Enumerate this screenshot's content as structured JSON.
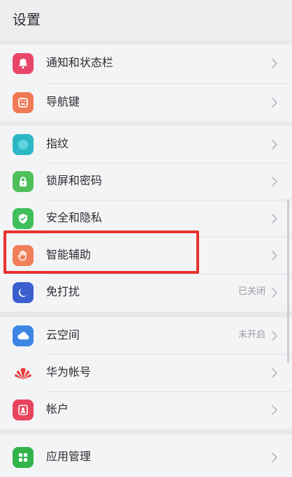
{
  "header": {
    "title": "设置"
  },
  "groups": [
    {
      "items": [
        {
          "label": "通知和状态栏",
          "icon": "bell-icon",
          "color": "#e9476a"
        },
        {
          "label": "导航键",
          "icon": "navigation-keys-icon",
          "color": "#f07a55"
        }
      ]
    },
    {
      "items": [
        {
          "label": "指纹",
          "icon": "fingerprint-icon",
          "color": "#2bb7c5"
        },
        {
          "label": "锁屏和密码",
          "icon": "lock-icon",
          "color": "#4fbf5c"
        },
        {
          "label": "安全和隐私",
          "icon": "shield-icon",
          "color": "#3fbf5a"
        },
        {
          "label": "智能辅助",
          "icon": "hand-icon",
          "color": "#f07e58"
        },
        {
          "label": "免打扰",
          "icon": "moon-icon",
          "color": "#3c5fd0",
          "status": "已关闭"
        }
      ]
    },
    {
      "items": [
        {
          "label": "云空间",
          "icon": "cloud-icon",
          "color": "#3d86e4",
          "status": "未开启"
        },
        {
          "label": "华为帐号",
          "icon": "huawei-logo-icon",
          "color": "#e93a3a"
        },
        {
          "label": "帐户",
          "icon": "account-icon",
          "color": "#e8455d"
        }
      ]
    },
    {
      "items": [
        {
          "label": "应用管理",
          "icon": "apps-icon",
          "color": "#33b44b"
        }
      ]
    }
  ]
}
